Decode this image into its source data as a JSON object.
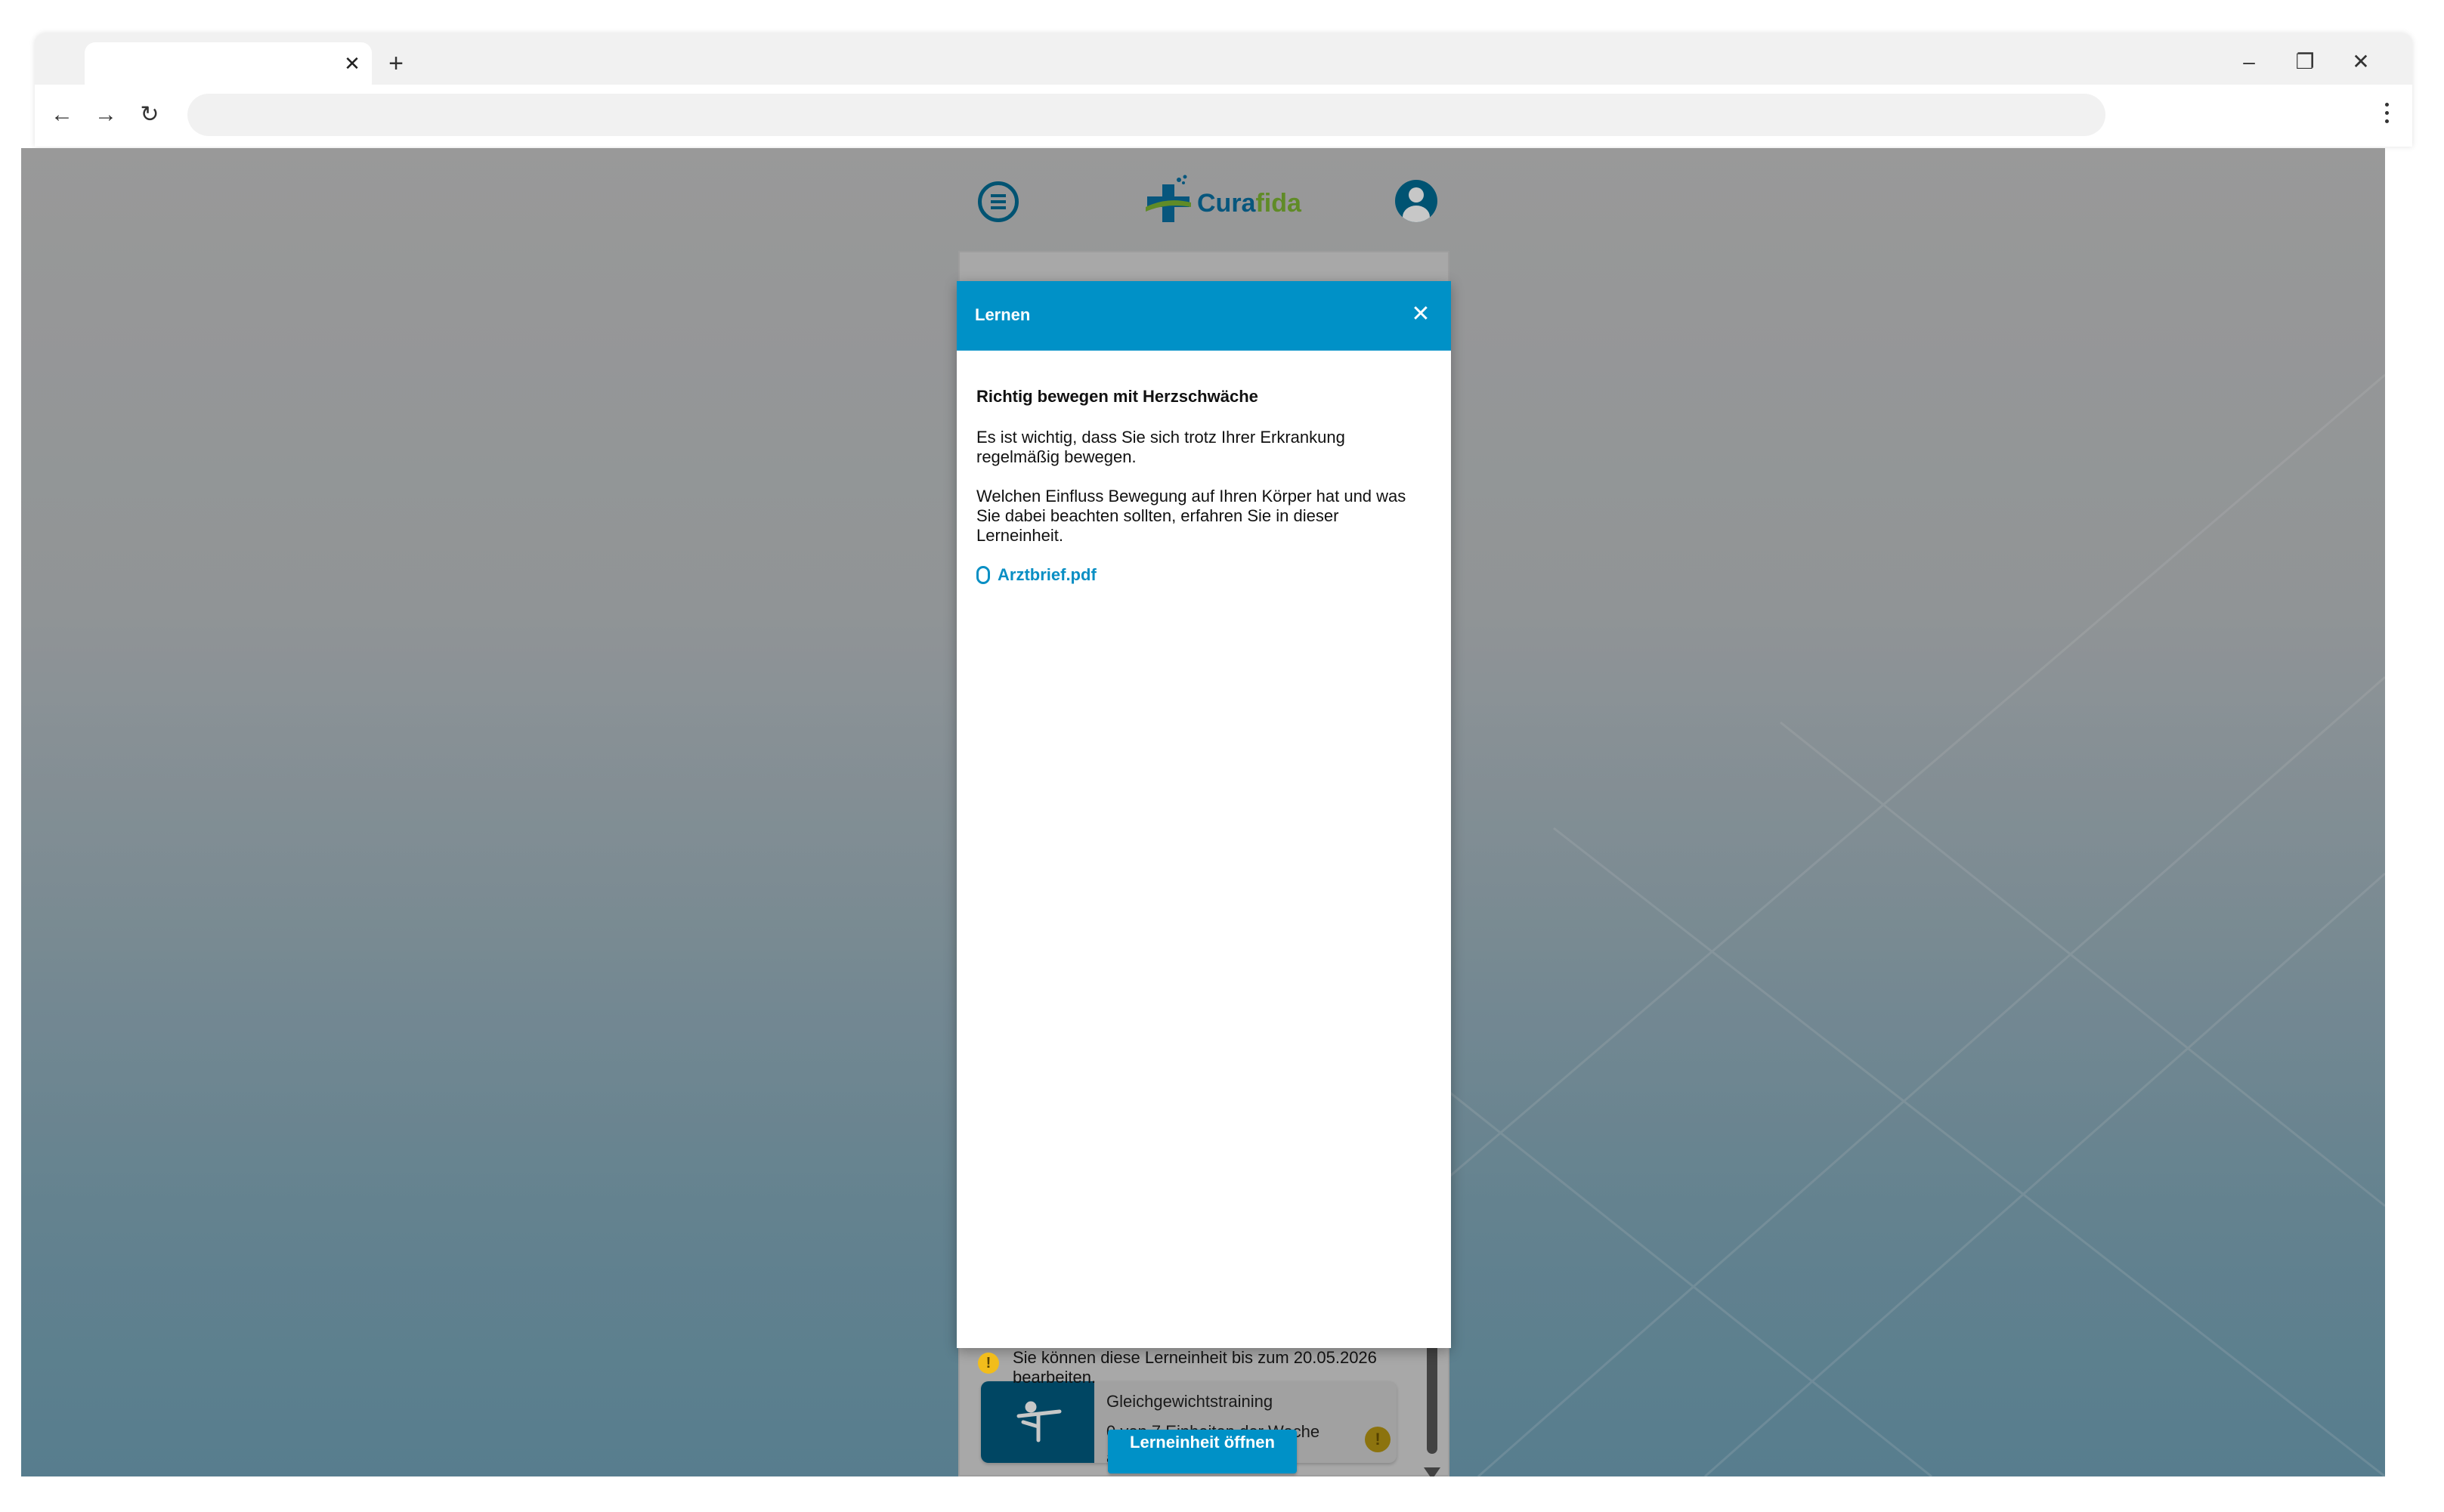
{
  "browser": {
    "tab_title": "",
    "new_tab_label": "+",
    "address": ""
  },
  "app": {
    "logo_left": "Cura",
    "logo_right": "fida"
  },
  "background_cards": [
    {
      "title": "Gleichgewichtstraining",
      "subtitle": "0 von 7 Einheiten der Woche abgeschlossen"
    }
  ],
  "modal": {
    "title": "Lernen",
    "heading": "Richtig bewegen mit Herzschwäche",
    "paragraph1": "Es ist wichtig, dass Sie sich trotz Ihrer Erkrankung regelmäßig bewegen.",
    "paragraph2": "Welchen Einfluss Bewegung auf Ihren Körper hat und was Sie dabei beachten sollten, erfahren Sie in dieser Lerneinheit.",
    "attachment": "Arztbrief.pdf",
    "notice": "Sie können diese Lerneinheit bis zum 20.05.2026 bearbeiten.",
    "button_label": "Lerneinheit öffnen"
  },
  "colors": {
    "primary": "#0091c7",
    "brand_green": "#7cb233",
    "warning": "#f2bd1b"
  }
}
